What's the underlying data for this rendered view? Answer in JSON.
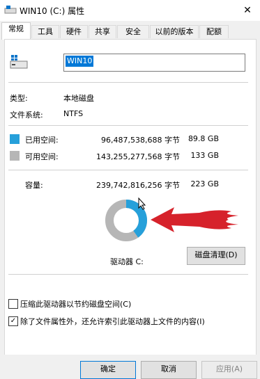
{
  "window": {
    "title": "WIN10 (C:) 属性",
    "close": "✕"
  },
  "tabs": [
    "常规",
    "工具",
    "硬件",
    "共享",
    "安全",
    "以前的版本",
    "配额"
  ],
  "drive_name_value": "WIN10",
  "info": {
    "type_label": "类型:",
    "type_value": "本地磁盘",
    "fs_label": "文件系统:",
    "fs_value": "NTFS"
  },
  "space": {
    "used_label": "已用空间:",
    "used_bytes": "96,487,538,688 字节",
    "used_size": "89.8 GB",
    "free_label": "可用空间:",
    "free_bytes": "143,255,277,568 字节",
    "free_size": "133 GB",
    "capacity_label": "容量:",
    "capacity_bytes": "239,742,816,256 字节",
    "capacity_size": "223 GB",
    "used_fraction": 0.402
  },
  "drive_label": "驱动器 C:",
  "cleanup_button": "磁盘清理(D)",
  "options": {
    "compress": "压缩此驱动器以节约磁盘空间(C)",
    "compress_checked": false,
    "index": "除了文件属性外，还允许索引此驱动器上文件的内容(I)",
    "index_checked": true
  },
  "buttons": {
    "ok": "确定",
    "cancel": "取消",
    "apply": "应用(A)"
  },
  "colors": {
    "used": "#26a0da",
    "free": "#b6b6b6",
    "arrow": "#d6222b",
    "accent": "#0078d7"
  }
}
